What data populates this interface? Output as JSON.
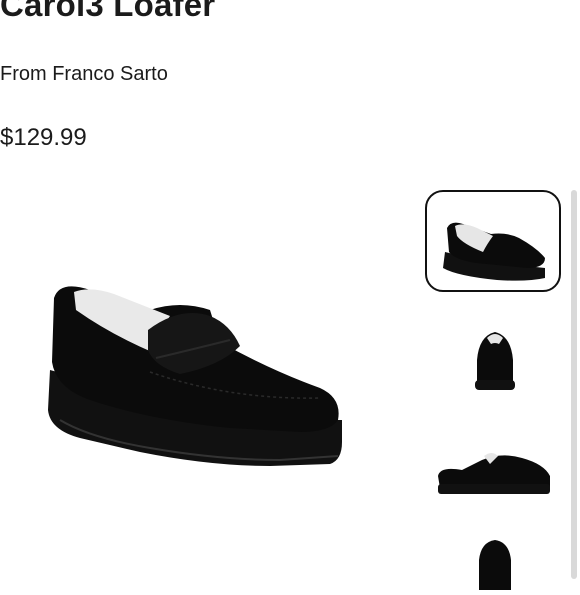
{
  "product": {
    "title": "Carol3 Loafer",
    "brand": "From Franco Sarto",
    "price": "$129.99"
  },
  "gallery": {
    "main_image_icon": "black-suede-loafer",
    "thumbnails": [
      {
        "icon": "loafer-side-view",
        "selected": true
      },
      {
        "icon": "loafer-front-view",
        "selected": false
      },
      {
        "icon": "loafer-profile-view",
        "selected": false
      },
      {
        "icon": "loafer-top-view",
        "selected": false
      }
    ]
  },
  "colors": {
    "text": "#1b1b1b",
    "shoe": "#0b0b0b",
    "lining": "#e9e9e9"
  }
}
